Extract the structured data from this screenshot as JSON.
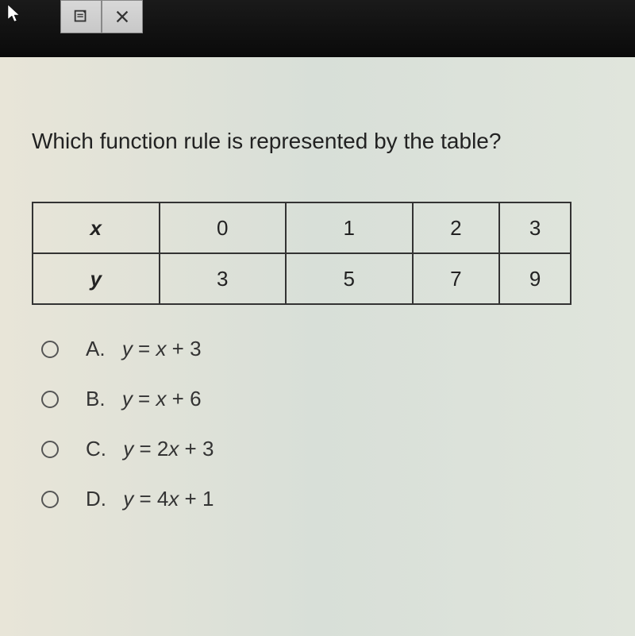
{
  "toolbar": {
    "note_icon": "note",
    "close_icon": "close"
  },
  "question": "Which function rule is represented by the table?",
  "table": {
    "rows": [
      {
        "label": "x",
        "c0": "0",
        "c1": "1",
        "c2": "2",
        "c3": "3"
      },
      {
        "label": "y",
        "c0": "3",
        "c1": "5",
        "c2": "7",
        "c3": "9"
      }
    ]
  },
  "options": {
    "a": {
      "letter": "A.",
      "eq": "y = x + 3"
    },
    "b": {
      "letter": "B.",
      "eq": "y = x + 6"
    },
    "c": {
      "letter": "C.",
      "eq": "y = 2x + 3"
    },
    "d": {
      "letter": "D.",
      "eq": "y = 4x + 1"
    }
  },
  "chart_data": {
    "type": "table",
    "columns": [
      "x",
      "0",
      "1",
      "2",
      "3"
    ],
    "rows": [
      [
        "y",
        3,
        5,
        7,
        9
      ]
    ],
    "title": "Which function rule is represented by the table?"
  }
}
